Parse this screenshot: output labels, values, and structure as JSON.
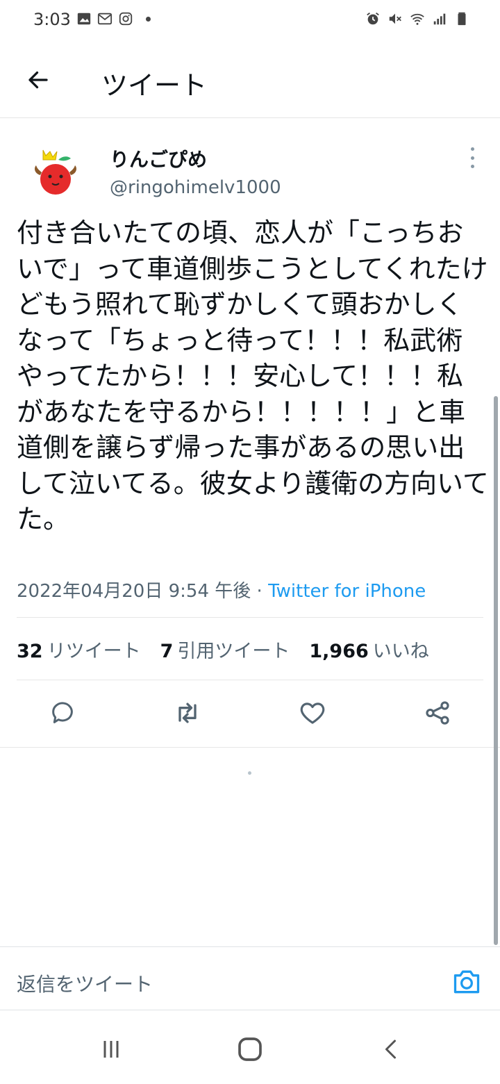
{
  "status_bar": {
    "time": "3:03",
    "left_icons": [
      "image-icon",
      "gmail-icon",
      "instagram-icon",
      "dot-icon"
    ],
    "right_icons": [
      "alarm-icon",
      "mute-icon",
      "wifi-icon",
      "signal-icon",
      "battery-icon"
    ]
  },
  "header": {
    "title": "ツイート",
    "back_icon": "arrow-left-icon"
  },
  "tweet": {
    "display_name": "りんごぴめ",
    "handle": "@ringohimelv1000",
    "text": "付き合いたての頃、恋人が「こっちおいで」って車道側歩こうとしてくれたけどもう照れて恥ずかしくて頭おかしくなって「ちょっと待って！！！私武術やってたから！！！安心して！！！私があなたを守るから！！！！！」と車道側を譲らず帰った事があるの思い出して泣いてる。彼女より護衛の方向いてた。",
    "timestamp": "2022年04月20日 9:54 午後",
    "separator": " · ",
    "source": "Twitter for iPhone"
  },
  "stats": [
    {
      "count": "32",
      "label": "リツイート"
    },
    {
      "count": "7",
      "label": "引用ツイート"
    },
    {
      "count": "1,966",
      "label": "いいね"
    }
  ],
  "actions": [
    "reply-icon",
    "retweet-icon",
    "like-icon",
    "share-icon"
  ],
  "reply_bar": {
    "placeholder": "返信をツイート",
    "camera_icon": "camera-icon"
  },
  "nav_bar": [
    "recent-apps-icon",
    "home-icon",
    "back-icon"
  ],
  "colors": {
    "accent": "#1d9bf0",
    "text_primary": "#0f1419",
    "text_secondary": "#536471",
    "divider": "#e6e6e6"
  }
}
